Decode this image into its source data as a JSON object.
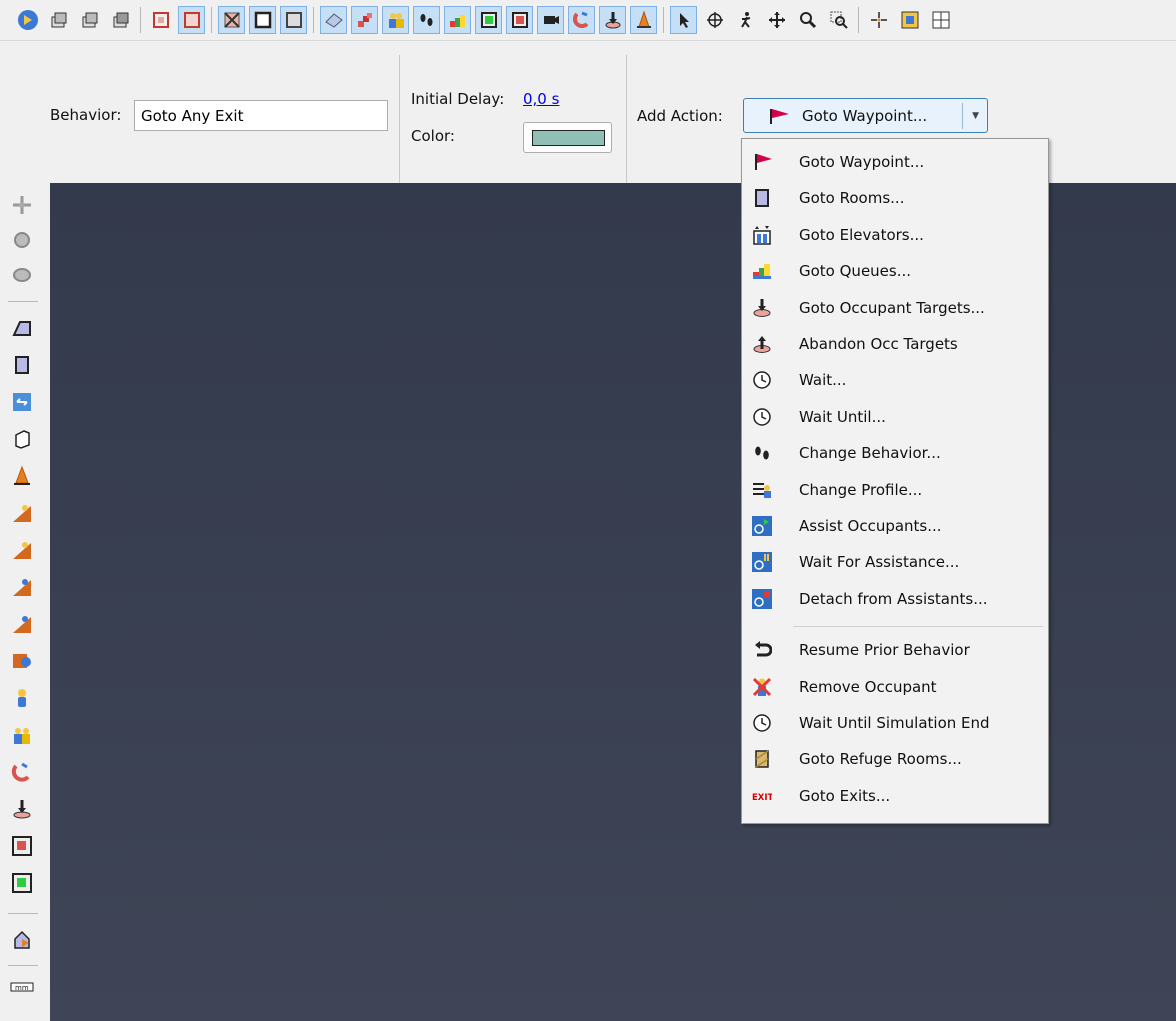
{
  "toolbar": {
    "icons": [
      "snap-icon",
      "floor-view-icon",
      "floor-view-icon",
      "floor-view-icon",
      "wall-view-icon",
      "wall-view-icon",
      "no-render-icon",
      "box-view-icon",
      "box-view-icon",
      "material-icon",
      "stairs-icon",
      "occupants-icon",
      "footsteps-icon",
      "queue-icon",
      "green-door-icon",
      "red-door-icon",
      "camera-icon",
      "magnet-icon",
      "target-icon",
      "cone-icon",
      "pointer-icon",
      "orbit-icon",
      "walk-icon",
      "pan-icon",
      "zoom-icon",
      "zoom-box-icon",
      "crosshair-icon",
      "fit-view-icon",
      "grid-view-icon"
    ]
  },
  "props": {
    "behavior_label": "Behavior:",
    "behavior_value": "Goto Any Exit",
    "delay_label": "Initial Delay:",
    "delay_value": "0,0 s",
    "color_label": "Color:",
    "color_value": "#8fbfb5",
    "add_action_label": "Add Action:",
    "add_action_selected": "Goto Waypoint..."
  },
  "menu": {
    "items": [
      {
        "icon": "flag-icon",
        "label": "Goto Waypoint..."
      },
      {
        "icon": "room-icon",
        "label": "Goto Rooms..."
      },
      {
        "icon": "elevator-icon",
        "label": "Goto Elevators..."
      },
      {
        "icon": "queue-icon",
        "label": "Goto Queues..."
      },
      {
        "icon": "target-down-icon",
        "label": "Goto Occupant Targets..."
      },
      {
        "icon": "target-up-icon",
        "label": "Abandon Occ Targets"
      },
      {
        "icon": "clock-icon",
        "label": "Wait..."
      },
      {
        "icon": "clock-icon",
        "label": "Wait Until..."
      },
      {
        "icon": "footsteps-icon",
        "label": "Change Behavior..."
      },
      {
        "icon": "profile-icon",
        "label": "Change Profile..."
      },
      {
        "icon": "assist-icon",
        "label": "Assist Occupants..."
      },
      {
        "icon": "wait-assist-icon",
        "label": "Wait For Assistance..."
      },
      {
        "icon": "detach-icon",
        "label": "Detach from Assistants..."
      },
      {
        "icon": "undo-arrow-icon",
        "label": "Resume Prior Behavior"
      },
      {
        "icon": "remove-occupant-icon",
        "label": "Remove Occupant"
      },
      {
        "icon": "clock-icon",
        "label": "Wait Until Simulation End"
      },
      {
        "icon": "refuge-room-icon",
        "label": "Goto Refuge Rooms..."
      },
      {
        "icon": "exit-icon",
        "label": "Goto Exits..."
      }
    ],
    "exit_icon_text": "EXIT"
  },
  "left_toolbar": {
    "icons": [
      "move-icon",
      "rotate-icon",
      "rotate-3d-icon",
      "polygon-room-icon",
      "rect-room-icon",
      "door-icon",
      "box-icon",
      "cone-icon",
      "stair-up-1-icon",
      "stair-up-2-icon",
      "ramp-1-icon",
      "ramp-2-icon",
      "box-person-icon",
      "person-icon",
      "group-icon",
      "magnet-icon",
      "target-icon",
      "red-door-icon",
      "green-door-icon",
      "export-icon",
      "ruler-icon"
    ],
    "ruler_text": "mm"
  }
}
